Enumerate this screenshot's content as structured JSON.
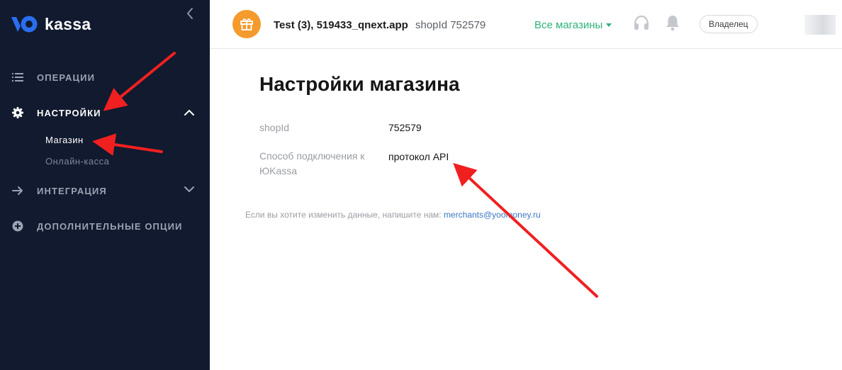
{
  "brand": {
    "name": "kassa"
  },
  "sidebar": {
    "items": [
      {
        "label": "ОПЕРАЦИИ",
        "icon": "list-icon"
      },
      {
        "label": "НАСТРОЙКИ",
        "icon": "gear-icon",
        "expanded": true,
        "children": [
          {
            "label": "Магазин",
            "active": true
          },
          {
            "label": "Онлайн-касса",
            "active": false
          }
        ]
      },
      {
        "label": "ИНТЕГРАЦИЯ",
        "icon": "arrow-right-icon",
        "expanded": false
      },
      {
        "label": "ДОПОЛНИТЕЛЬНЫЕ ОПЦИИ",
        "icon": "plus-circle-icon"
      }
    ]
  },
  "header": {
    "shop_name": "Test (3), 519433_qnext.app",
    "shop_id": "shopId 752579",
    "stores_select": "Все магазины",
    "role": "Владелец",
    "icons": [
      "gift-icon",
      "headset-icon",
      "bell-icon"
    ]
  },
  "main": {
    "title": "Настройки магазина",
    "fields": [
      {
        "label": "shopId",
        "value": "752579"
      },
      {
        "label": "Способ подключения к ЮKassa",
        "value": "протокол API"
      }
    ],
    "footnote": "Если вы хотите изменить данные, напишите нам:",
    "footnote_email": "merchants@yoomoney.ru"
  },
  "colors": {
    "sidebar_bg": "#111a2e",
    "accent_green": "#2db37a",
    "avatar_orange": "#f59a2c",
    "link_blue": "#3c77c2",
    "annotation_red": "#f02020"
  }
}
